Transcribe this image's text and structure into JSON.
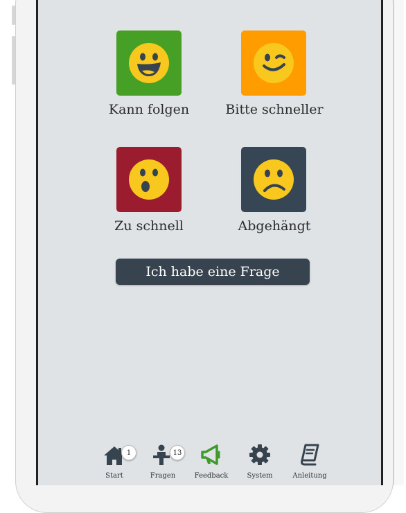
{
  "colors": {
    "screen_bg": "#dfe3e6",
    "tile_green": "#45a025",
    "tile_orange": "#ff9c00",
    "tile_red": "#9a1c2e",
    "tile_dark": "#364654",
    "emoji_yellow": "#f8c81e",
    "button_dark": "#37444f",
    "feedback_active": "#3f9a2a"
  },
  "feedback": {
    "options": [
      {
        "label": "Kann folgen",
        "icon": "laughing-face-icon"
      },
      {
        "label": "Bitte schneller",
        "icon": "winking-face-icon"
      },
      {
        "label": "Zu schnell",
        "icon": "surprised-face-icon"
      },
      {
        "label": "Abgehängt",
        "icon": "sad-face-icon"
      }
    ],
    "question_button": "Ich habe eine Frage"
  },
  "tabbar": {
    "items": [
      {
        "label": "Start",
        "icon": "home-icon",
        "badge": "1"
      },
      {
        "label": "Fragen",
        "icon": "presenter-icon",
        "badge": "13"
      },
      {
        "label": "Feedback",
        "icon": "megaphone-icon",
        "badge": null,
        "active": true
      },
      {
        "label": "System",
        "icon": "gear-icon",
        "badge": null
      },
      {
        "label": "Anleitung",
        "icon": "book-icon",
        "badge": null
      }
    ]
  }
}
